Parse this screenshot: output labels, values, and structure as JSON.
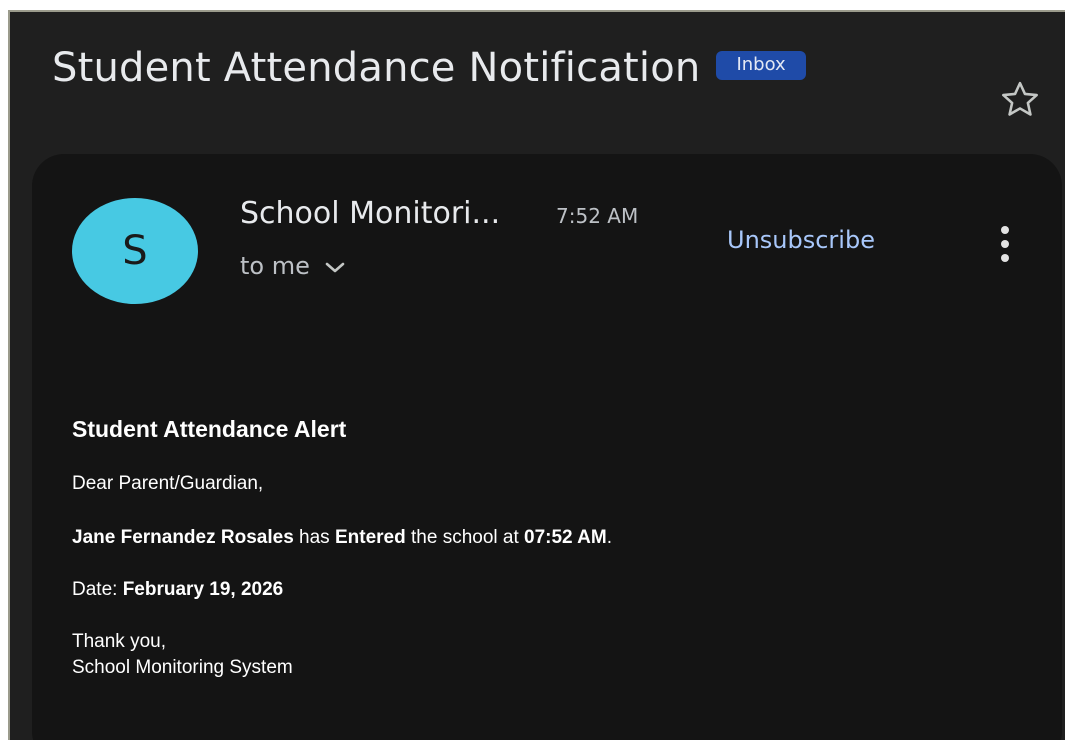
{
  "header": {
    "subject": "Student Attendance Notification",
    "label": "Inbox"
  },
  "icons": {
    "star": "star-outline-icon",
    "chevron": "chevron-down-icon",
    "more": "more-vertical-icon"
  },
  "message": {
    "avatar_letter": "S",
    "sender": "School Monitori...",
    "time": "7:52 AM",
    "recipient": "to me",
    "unsubscribe": "Unsubscribe",
    "body": {
      "title": "Student Attendance Alert",
      "greeting": "Dear Parent/Guardian,",
      "student_name": "Jane Fernandez Rosales",
      "text_has": " has ",
      "action": "Entered",
      "text_school_at": " the school at ",
      "entry_time": "07:52 AM",
      "text_period": ".",
      "date_label": "Date: ",
      "date_value": "February 19, 2026",
      "closing": "Thank you,",
      "signature": "School Monitoring System"
    }
  },
  "colors": {
    "background": "#1f1f1f",
    "card": "#141414",
    "avatar": "#47c9e3",
    "badge": "#1f4ba8",
    "link": "#a8c7fa",
    "text": "#e8eaed"
  }
}
